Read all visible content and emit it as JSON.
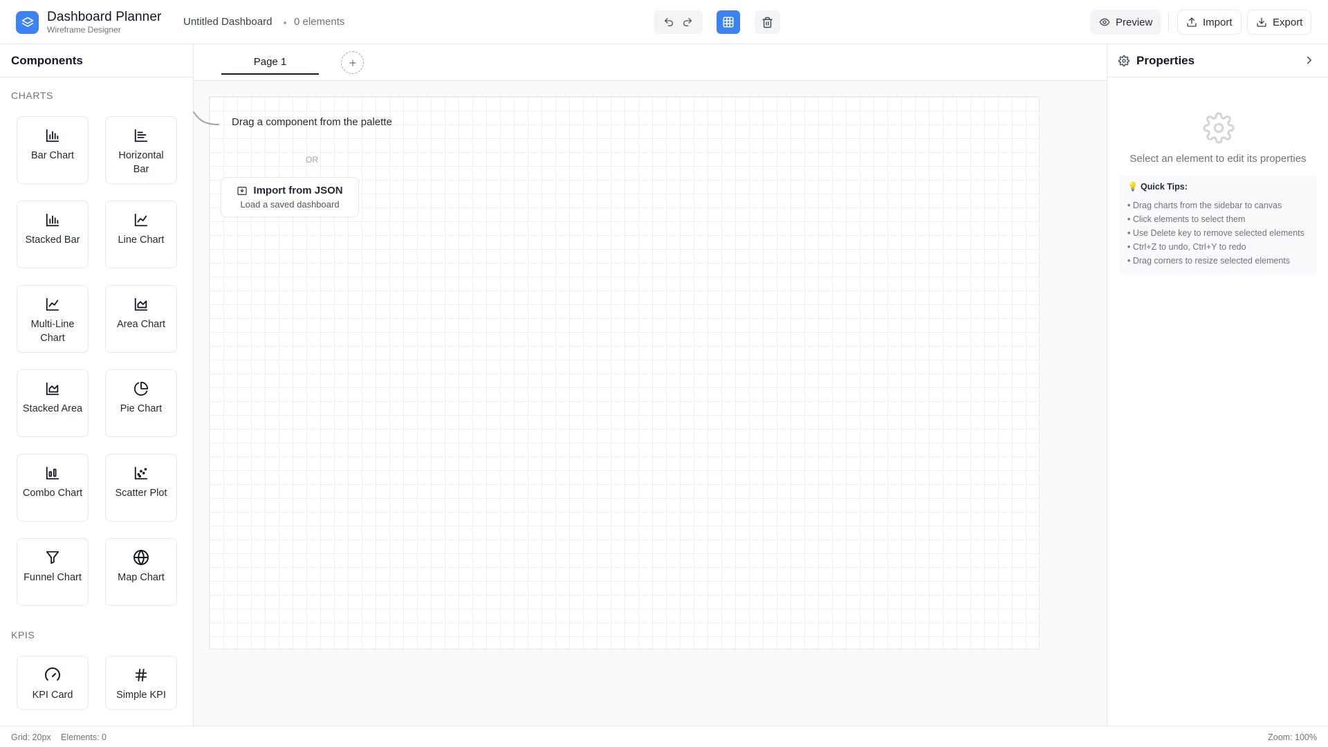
{
  "header": {
    "app_title": "Dashboard Planner",
    "app_subtitle": "Wireframe Designer",
    "dashboard_name": "Untitled Dashboard",
    "element_count": "0 elements",
    "preview_label": "Preview",
    "import_label": "Import",
    "export_label": "Export",
    "accent_color": "#3b82f6"
  },
  "sidebar": {
    "title": "Components",
    "sections": [
      {
        "title": "CHARTS",
        "items": [
          {
            "label": "Bar Chart",
            "icon": "bar-chart-icon"
          },
          {
            "label": "Horizontal Bar",
            "icon": "horizontal-bar-icon"
          },
          {
            "label": "Stacked Bar",
            "icon": "stacked-bar-icon"
          },
          {
            "label": "Line Chart",
            "icon": "line-chart-icon"
          },
          {
            "label": "Multi-Line Chart",
            "icon": "multi-line-icon"
          },
          {
            "label": "Area Chart",
            "icon": "area-chart-icon"
          },
          {
            "label": "Stacked Area",
            "icon": "stacked-area-icon"
          },
          {
            "label": "Pie Chart",
            "icon": "pie-chart-icon"
          },
          {
            "label": "Combo Chart",
            "icon": "combo-chart-icon"
          },
          {
            "label": "Scatter Plot",
            "icon": "scatter-plot-icon"
          },
          {
            "label": "Funnel Chart",
            "icon": "funnel-icon"
          },
          {
            "label": "Map Chart",
            "icon": "globe-icon"
          }
        ]
      },
      {
        "title": "KPIS",
        "items": [
          {
            "label": "KPI Card",
            "icon": "gauge-icon"
          },
          {
            "label": "Simple KPI",
            "icon": "hash-icon"
          }
        ]
      }
    ]
  },
  "canvas": {
    "tabs": [
      {
        "label": "Page 1"
      }
    ],
    "hint": "Drag a component from the palette",
    "or_text": "OR",
    "import_title": "Import from JSON",
    "import_subtitle": "Load a saved dashboard"
  },
  "properties": {
    "title": "Properties",
    "empty_message": "Select an element to edit its properties",
    "tips_title": "💡 Quick Tips:",
    "tips": [
      "• Drag charts from the sidebar to canvas",
      "• Click elements to select them",
      "• Use Delete key to remove selected elements",
      "• Ctrl+Z to undo, Ctrl+Y to redo",
      "• Drag corners to resize selected elements"
    ]
  },
  "status": {
    "grid": "Grid: 20px",
    "elements": "Elements: 0",
    "zoom": "Zoom: 100%"
  }
}
